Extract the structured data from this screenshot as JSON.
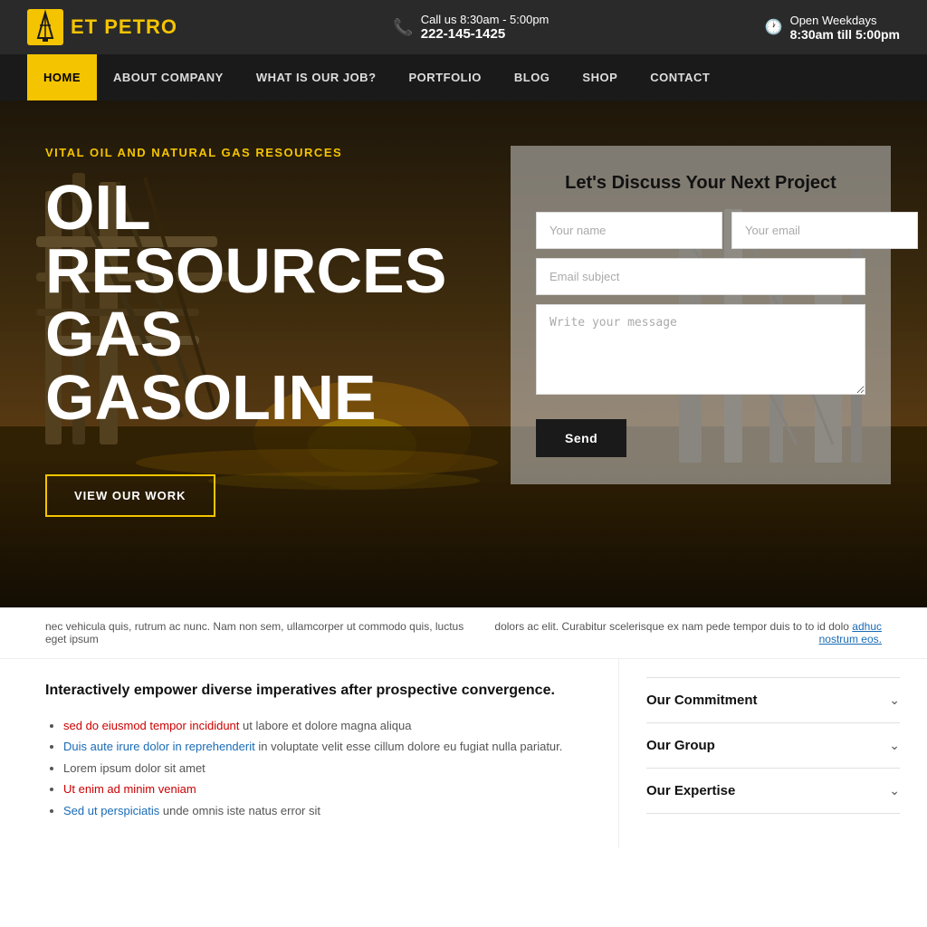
{
  "brand": {
    "name_prefix": "ET ",
    "name_accent": "PETRO",
    "logo_icon": "⚙"
  },
  "topbar": {
    "phone_label": "Call us 8:30am - 5:00pm",
    "phone_number": "222-145-1425",
    "hours_label": "Open Weekdays",
    "hours_value": "8:30am till 5:00pm"
  },
  "nav": {
    "items": [
      {
        "label": "HOME",
        "active": true
      },
      {
        "label": "ABOUT COMPANY",
        "active": false
      },
      {
        "label": "WHAT IS OUR JOB?",
        "active": false
      },
      {
        "label": "PORTFOLIO",
        "active": false
      },
      {
        "label": "BLOG",
        "active": false
      },
      {
        "label": "SHOP",
        "active": false
      },
      {
        "label": "CONTACT",
        "active": false
      }
    ]
  },
  "hero": {
    "subtitle": "VITAL OIL AND NATURAL GAS RESOURCES",
    "main_title_line1": "OIL",
    "main_title_line2": "RESOURCES",
    "main_title_line3": "GAS",
    "main_title_line4": "GASOLINE",
    "cta_label": "VIEW OUR WORK"
  },
  "contact_form": {
    "title": "Let's Discuss Your Next Project",
    "name_placeholder": "Your name",
    "email_placeholder": "Your email",
    "subject_placeholder": "Email subject",
    "message_placeholder": "Write your message",
    "send_label": "Send"
  },
  "lorem_strip": {
    "left_text": "nec vehicula quis, rutrum ac nunc. Nam non sem, ullamcorper ut commodo quis, luctus eget ipsum",
    "right_text": "dolors ac elit. Curabitur scelerisque ex nam pede tempor duis to to id dolo",
    "right_link_text": "adhuc nostrum eos."
  },
  "bottom_left": {
    "heading": "Interactively empower diverse imperatives after prospective convergence.",
    "items": [
      {
        "text": "sed do eiusmod tempor incididunt",
        "link_part": "sed do eiusmod tempor incididunt",
        "link_color": "red",
        "rest": " ut labore et dolore magna aliqua"
      },
      {
        "text": "Duis aute irure dolor in reprehenderit in voluptate velit esse cillum dolore eu fugiat nulla pariatur.",
        "link_part": "Duis aute irure dolor",
        "link_color": "blue",
        "rest": " in reprehenderit in voluptate velit esse cillum dolore eu fugiat nulla pariatur."
      },
      {
        "plain": "Lorem ipsum dolor sit amet"
      },
      {
        "text": "Ut enim ad minim veniam",
        "link_part": "Ut enim ad minim veniam",
        "link_color": "red"
      },
      {
        "text": "Sed ut perspiciatis unde omnis iste natus error sit",
        "link_part": "Sed ut perspiciatis",
        "link_color": "blue",
        "rest": " unde omnis iste natus error sit"
      }
    ]
  },
  "accordion": {
    "items": [
      {
        "label": "Our Commitment"
      },
      {
        "label": "Our Group"
      },
      {
        "label": "Our Expertise"
      }
    ]
  }
}
